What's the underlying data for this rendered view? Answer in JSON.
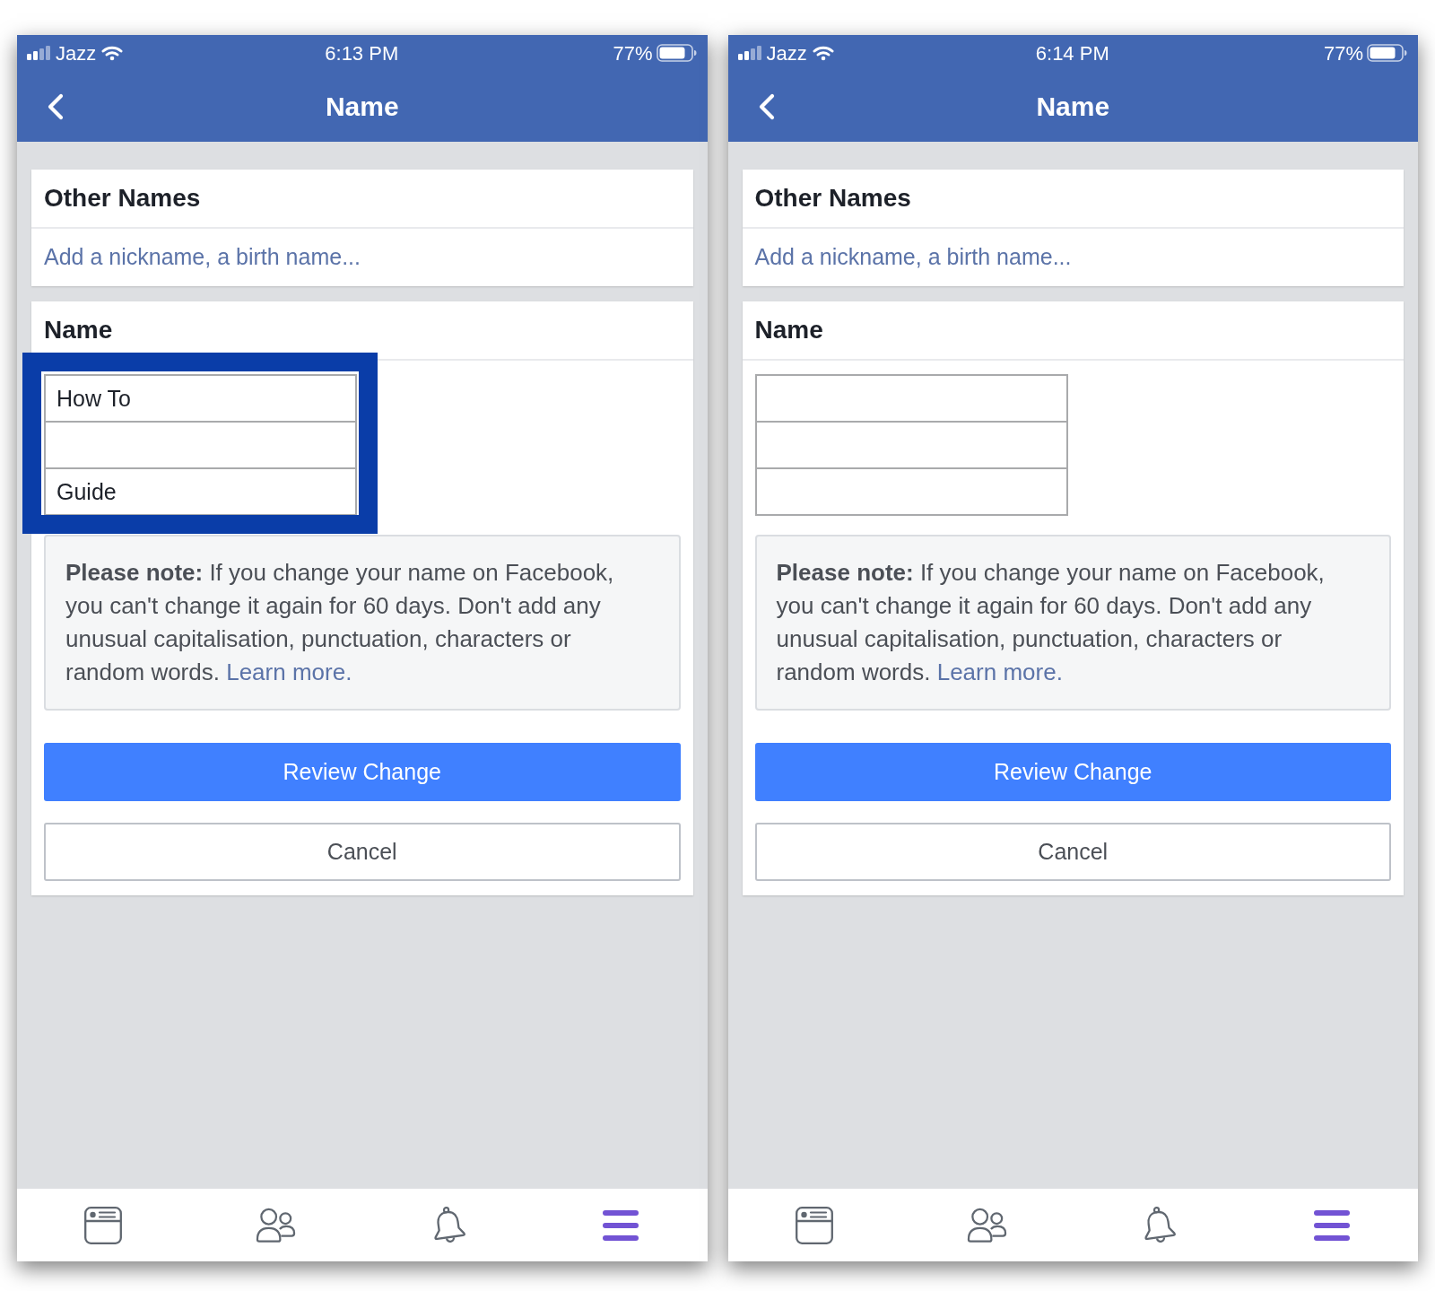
{
  "phones": [
    {
      "status_bar": {
        "carrier": "Jazz",
        "time": "6:13 PM",
        "battery": "77%"
      },
      "title": "Name",
      "other_names": {
        "title": "Other Names",
        "link": "Add a nickname, a birth name..."
      },
      "name_section": {
        "title": "Name",
        "highlighted": true,
        "field_values": {
          "field_1": "How To",
          "field_3": "Guide"
        },
        "note": "**Please note:** If you change your name on Facebook, you can't change it again for 60 days. Don't add any unusual capitalisation, punctuation, characters or random words.",
        "note_link": "Learn more.",
        "buttons": [
          {
            "label": "Review Change",
            "kind": "primary"
          },
          {
            "label": "Cancel",
            "kind": "secondary"
          }
        ]
      },
      "tab_bar": [
        {
          "selected": false
        },
        {
          "selected": false
        },
        {
          "selected": false
        },
        {
          "selected": true
        }
      ]
    },
    {
      "status_bar": {
        "carrier": "Jazz",
        "time": "6:14 PM",
        "battery": "77%"
      },
      "title": "Name",
      "other_names": {
        "title": "Other Names",
        "link": "Add a nickname, a birth name..."
      },
      "name_section": {
        "title": "Name",
        "note": "**Please note:** If you change your name on Facebook, you can't change it again for 60 days. Don't add any unusual capitalisation, punctuation, characters or random words.",
        "note_link": "Learn more.",
        "buttons": [
          {
            "label": "Review Change",
            "kind": "primary"
          },
          {
            "label": "Cancel",
            "kind": "secondary"
          }
        ]
      },
      "tab_bar": [
        {
          "selected": false
        },
        {
          "selected": false
        },
        {
          "selected": false
        },
        {
          "selected": true
        }
      ]
    }
  ]
}
